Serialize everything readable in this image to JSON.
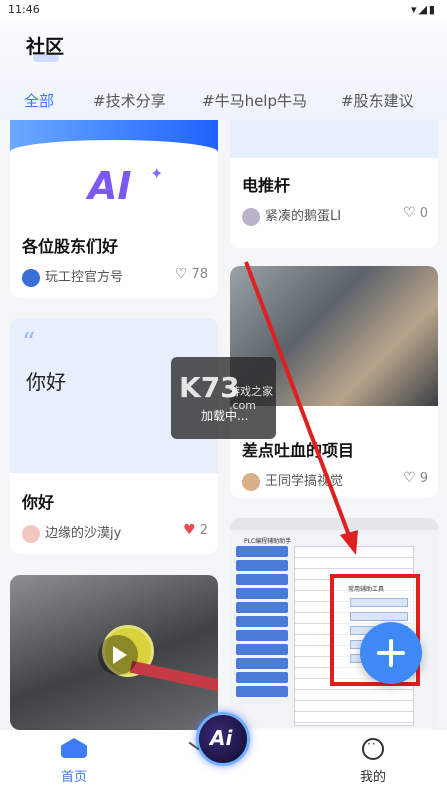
{
  "status": {
    "time": "11:46",
    "icons": "▾◢▮"
  },
  "header": {
    "title": "社区"
  },
  "tabs": [
    {
      "label": "全部",
      "active": true
    },
    {
      "label": "#技术分享"
    },
    {
      "label": "#牛马help牛马"
    },
    {
      "label": "#股东建议"
    }
  ],
  "posts": [
    {
      "title": "各位股东们好",
      "author": "玩工控官方号",
      "likes": "78",
      "liked": false,
      "image_text": "AI"
    },
    {
      "title": "你好",
      "author": "边缘的沙漠jy",
      "likes": "2",
      "liked": true,
      "image_text": "你好"
    },
    {
      "title": "电推杆",
      "author": "紧凑的鹅蛋LI",
      "likes": "0",
      "liked": false
    },
    {
      "title": "差点吐血的项目",
      "author": "王同学搞视觉",
      "likes": "9",
      "liked": false
    },
    {
      "title": "",
      "author": "",
      "likes": "",
      "screenshot": {
        "window_title": "PLC编程辅助助手",
        "dialog_title": "常用辅助工具"
      }
    }
  ],
  "overlay": {
    "brand": "K73",
    "brand_sub": "游戏之家\n.com",
    "loading": "加载中..."
  },
  "nav": {
    "home": "首页",
    "ai": "Ai",
    "mine": "我的"
  },
  "colors": {
    "accent": "#3d7cf2",
    "like_red": "#e94b55",
    "fab": "#3d8af7"
  }
}
